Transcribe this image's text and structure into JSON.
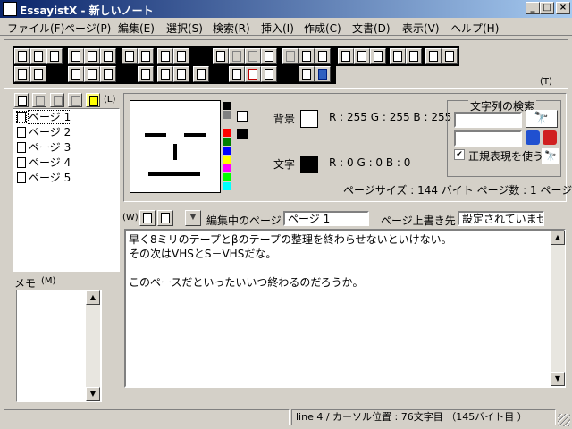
{
  "window": {
    "title": "EssayistX - 新しいノート",
    "minimize": "_",
    "maximize": "□",
    "close": "×"
  },
  "menu": [
    "ファイル(F)",
    "ページ(P)",
    "編集(E)",
    "選択(S)",
    "検索(R)",
    "挿入(I)",
    "作成(C)",
    "文書(D)",
    "表示(V)",
    "ヘルプ(H)"
  ],
  "toolbar": {
    "hotkey_t": "(T)"
  },
  "pages": {
    "hotkey_l": "(L)",
    "items": [
      "ページ 1",
      "ページ 2",
      "ページ 3",
      "ページ 4",
      "ページ 5"
    ],
    "selected": 0
  },
  "colors": {
    "bg_label": "背景",
    "bg_rgb": "R : 255   G : 255   B : 255",
    "fg_label": "文字",
    "fg_rgb": "R : 0      G : 0      B : 0",
    "background": "#ffffff",
    "foreground": "#000000",
    "palette": [
      "#000000",
      "#808080",
      "#ff0000",
      "#008000",
      "#0000ff",
      "#ffff00",
      "#ff00ff",
      "#00ff00",
      "#00ffff"
    ]
  },
  "search": {
    "title": "文字列の検索",
    "regex_label": "正規表現を使う",
    "regex_checked": true,
    "checkmark": "✔"
  },
  "page_info": "ページサイズ : 144 バイト   ページ数 : 1 ページ",
  "editbar": {
    "hotkey_w": "(W)",
    "editing_label": "編集中のページ",
    "editing_value": "ページ 1",
    "overwrite_label": "ページ上書き先",
    "overwrite_value": "設定されていません"
  },
  "memo": {
    "label": "メモ",
    "hotkey": "(M)"
  },
  "editor": {
    "lines": [
      "早く8ミリのテープとβのテープの整理を終わらせないといけない。",
      "その次はVHSとS－VHSだな。",
      "",
      "このペースだといったいいつ終わるのだろうか。"
    ]
  },
  "status": {
    "cursor": "line 4 / カーソル位置 : 76文字目 （145バイト目 ）"
  }
}
